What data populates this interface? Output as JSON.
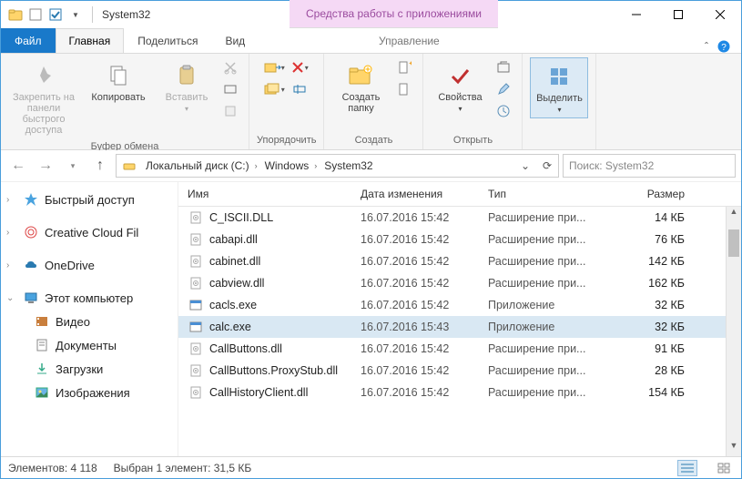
{
  "title": "System32",
  "context_group": "Средства работы с приложениями",
  "tabs": {
    "file": "Файл",
    "home": "Главная",
    "share": "Поделиться",
    "view": "Вид",
    "manage": "Управление"
  },
  "ribbon": {
    "clipboard": {
      "label": "Буфер обмена",
      "pin": "Закрепить на панели\nбыстрого доступа",
      "copy": "Копировать",
      "paste": "Вставить"
    },
    "organize": {
      "label": "Упорядочить"
    },
    "new": {
      "label": "Создать",
      "newfolder": "Создать\nпапку"
    },
    "open": {
      "label": "Открыть",
      "props": "Свойства"
    },
    "select": {
      "label": "",
      "select": "Выделить"
    }
  },
  "breadcrumb": [
    "Локальный диск (C:)",
    "Windows",
    "System32"
  ],
  "search_placeholder": "Поиск: System32",
  "nav": {
    "quick": "Быстрый доступ",
    "ccf": "Creative Cloud Fil",
    "onedrive": "OneDrive",
    "thispc": "Этот компьютер",
    "videos": "Видео",
    "docs": "Документы",
    "downloads": "Загрузки",
    "pictures": "Изображения"
  },
  "columns": {
    "name": "Имя",
    "date": "Дата изменения",
    "type": "Тип",
    "size": "Размер"
  },
  "files": [
    {
      "name": "C_ISCII.DLL",
      "date": "16.07.2016 15:42",
      "type": "Расширение при...",
      "size": "14 КБ",
      "kind": "dll"
    },
    {
      "name": "cabapi.dll",
      "date": "16.07.2016 15:42",
      "type": "Расширение при...",
      "size": "76 КБ",
      "kind": "dll"
    },
    {
      "name": "cabinet.dll",
      "date": "16.07.2016 15:42",
      "type": "Расширение при...",
      "size": "142 КБ",
      "kind": "dll"
    },
    {
      "name": "cabview.dll",
      "date": "16.07.2016 15:42",
      "type": "Расширение при...",
      "size": "162 КБ",
      "kind": "dll"
    },
    {
      "name": "cacls.exe",
      "date": "16.07.2016 15:42",
      "type": "Приложение",
      "size": "32 КБ",
      "kind": "exe"
    },
    {
      "name": "calc.exe",
      "date": "16.07.2016 15:43",
      "type": "Приложение",
      "size": "32 КБ",
      "kind": "exe",
      "selected": true
    },
    {
      "name": "CallButtons.dll",
      "date": "16.07.2016 15:42",
      "type": "Расширение при...",
      "size": "91 КБ",
      "kind": "dll"
    },
    {
      "name": "CallButtons.ProxyStub.dll",
      "date": "16.07.2016 15:42",
      "type": "Расширение при...",
      "size": "28 КБ",
      "kind": "dll"
    },
    {
      "name": "CallHistoryClient.dll",
      "date": "16.07.2016 15:42",
      "type": "Расширение при...",
      "size": "154 КБ",
      "kind": "dll"
    }
  ],
  "status": {
    "count": "Элементов: 4 118",
    "selection": "Выбран 1 элемент: 31,5 КБ"
  }
}
